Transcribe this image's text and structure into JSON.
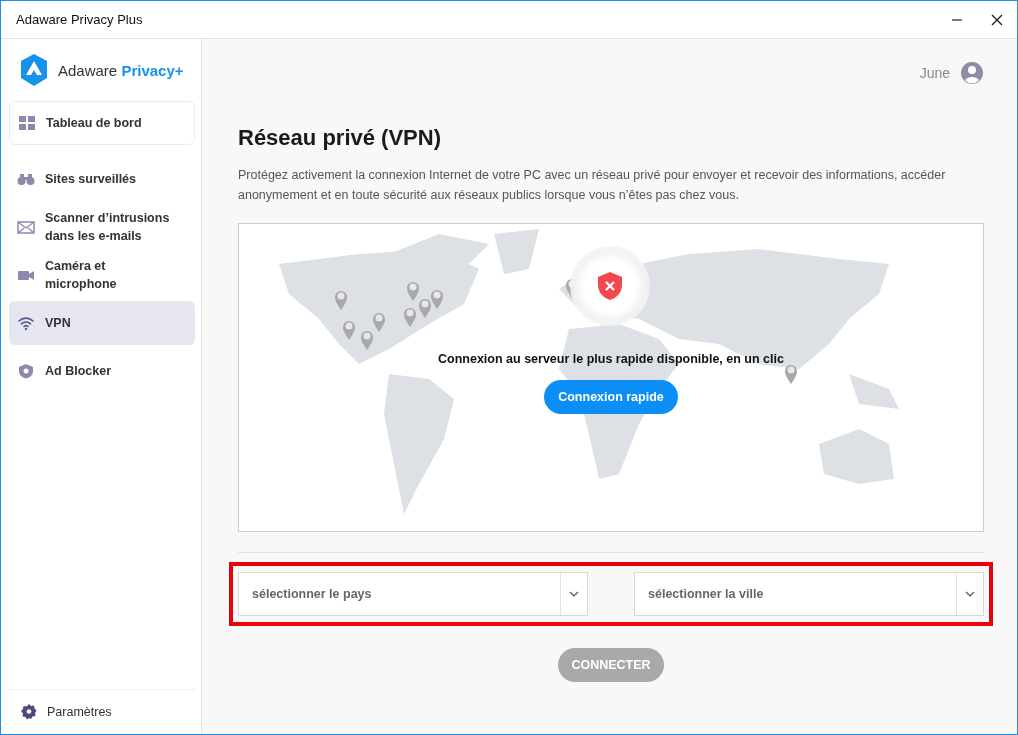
{
  "window": {
    "title": "Adaware Privacy Plus"
  },
  "brand": {
    "name": "Adaware",
    "suffix": "Privacy+"
  },
  "sidebar": {
    "items": [
      {
        "kind": "dashboard",
        "label": "Tableau de bord",
        "selected": false
      },
      {
        "kind": "binoculars",
        "label": "Sites surveillés",
        "selected": false
      },
      {
        "kind": "mail",
        "label": "Scanner d’intrusions dans les e-mails",
        "selected": false
      },
      {
        "kind": "camera",
        "label": "Caméra et microphone",
        "selected": false
      },
      {
        "kind": "wifi",
        "label": "VPN",
        "selected": true
      },
      {
        "kind": "shield",
        "label": "Ad Blocker",
        "selected": false
      }
    ],
    "footer": {
      "label": "Paramètres"
    }
  },
  "user": {
    "name": "June"
  },
  "page": {
    "title": "Réseau privé (VPN)",
    "description": "Protégez activement la connexion Internet de votre PC avec un réseau privé pour envoyer et recevoir des informations, accéder anonymement et en toute sécurité aux réseaux publics lorsque vous n’êtes pas chez vous."
  },
  "map": {
    "connected": false,
    "message": "Connexion au serveur le plus rapide disponible, en un clic",
    "button": "Connexion rapide"
  },
  "location_selectors": {
    "highlighted": true,
    "country": {
      "placeholder": "sélectionner le pays"
    },
    "city": {
      "placeholder": "sélectionner la ville"
    }
  },
  "connect_button": {
    "label": "CONNECTER",
    "disabled": true
  }
}
